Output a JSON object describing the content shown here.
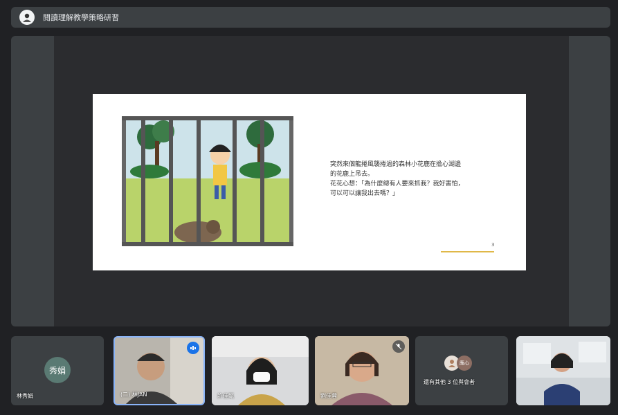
{
  "meeting": {
    "title": "閱讀理解教學策略研習",
    "owner_avatar_icon": "owner-avatar-icon"
  },
  "slide": {
    "lines": [
      "突然來個龍捲風襲捲過的森林小花鹿在擔心湖邊",
      "的花鹿上吊去。",
      "花花心想：「為什麼總有人要來抓我？我好害怕，",
      "可以可以讓我出去嗎？」"
    ],
    "page_number": "3"
  },
  "participants": [
    {
      "name": "林秀娟",
      "avatar_text": "秀娟",
      "type": "avatar"
    },
    {
      "name": "(二) 林JAN",
      "type": "video",
      "speaking": true
    },
    {
      "name": "許佳甄",
      "type": "video"
    },
    {
      "name": "劉佳蓉",
      "type": "video",
      "muted": true
    },
    {
      "name": "還有其他 3 位與會者",
      "type": "others",
      "avatar_text": "應心"
    },
    {
      "name": "",
      "type": "video"
    }
  ],
  "colors": {
    "background": "#202124",
    "panel": "#3c4043",
    "speaking_border": "#8ab4f8",
    "slide_accent": "#e0b848"
  }
}
